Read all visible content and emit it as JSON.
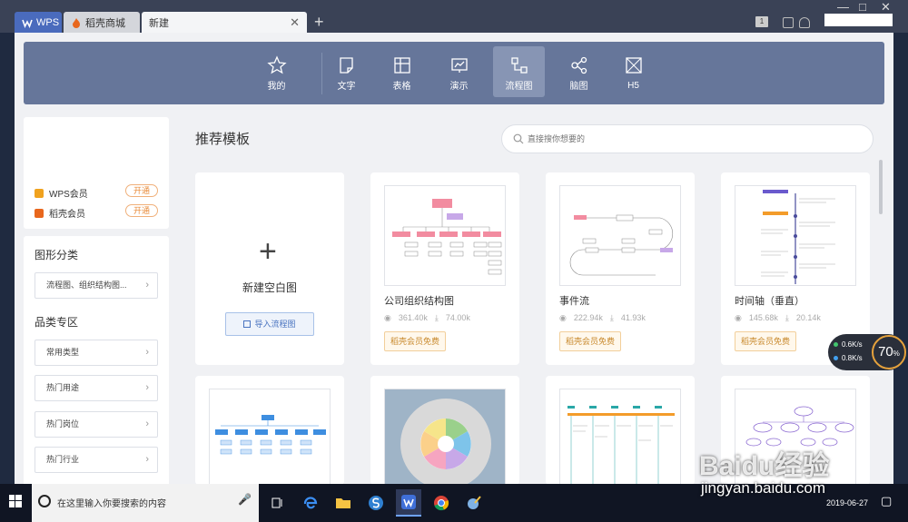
{
  "titlebar": {
    "tabs": [
      {
        "label": "WPS"
      },
      {
        "label": "稻壳商城"
      },
      {
        "label": "新建"
      }
    ],
    "new_tab": "+",
    "minimize": "—",
    "maximize": "□",
    "close": "✕",
    "tab_close": "✕",
    "badge": "1"
  },
  "ribbon": {
    "items": [
      {
        "label": "我的",
        "icon": "star-icon"
      },
      {
        "label": "文字",
        "icon": "document-icon"
      },
      {
        "label": "表格",
        "icon": "table-icon"
      },
      {
        "label": "演示",
        "icon": "presentation-icon"
      },
      {
        "label": "流程图",
        "icon": "flowchart-icon"
      },
      {
        "label": "脑图",
        "icon": "mindmap-icon"
      },
      {
        "label": "H5",
        "icon": "h5-icon"
      }
    ],
    "active": "流程图"
  },
  "membership": {
    "items": [
      {
        "label": "WPS会员",
        "button": "开通",
        "color": "#f0a21f"
      },
      {
        "label": "稻壳会员",
        "button": "开通",
        "color": "#e8671d"
      }
    ]
  },
  "sidebar": {
    "category_heading": "图形分类",
    "category_select": "流程图、组织结构图...",
    "zone_heading": "品类专区",
    "zone_items": [
      "常用类型",
      "热门用途",
      "热门岗位",
      "热门行业"
    ],
    "chevron": "›"
  },
  "main": {
    "title": "推荐模板",
    "search_placeholder": "直接搜你想要的",
    "blank": {
      "plus": "+",
      "label": "新建空白图",
      "import": "导入流程图"
    },
    "templates": [
      {
        "name": "公司组织结构图",
        "views": "361.40k",
        "downloads": "74.00k",
        "tag": "稻壳会员免费"
      },
      {
        "name": "事件流",
        "views": "222.94k",
        "downloads": "41.93k",
        "tag": "稻壳会员免费"
      },
      {
        "name": "时间轴（垂直）",
        "views": "145.68k",
        "downloads": "20.14k",
        "tag": "稻壳会员免费"
      }
    ]
  },
  "network": {
    "up": "0.6K/s",
    "down": "0.8K/s",
    "percent": "70",
    "pct_sign": "%"
  },
  "watermark": {
    "brand": "Baidu经验",
    "url": "jingyan.baidu.com"
  },
  "taskbar": {
    "search_text": "在这里输入你要搜索的内容",
    "time": "2019-06-27"
  },
  "colors": {
    "accent": "#66769a",
    "active_tab": "#8795b4",
    "member_orange": "#e88b3a"
  }
}
